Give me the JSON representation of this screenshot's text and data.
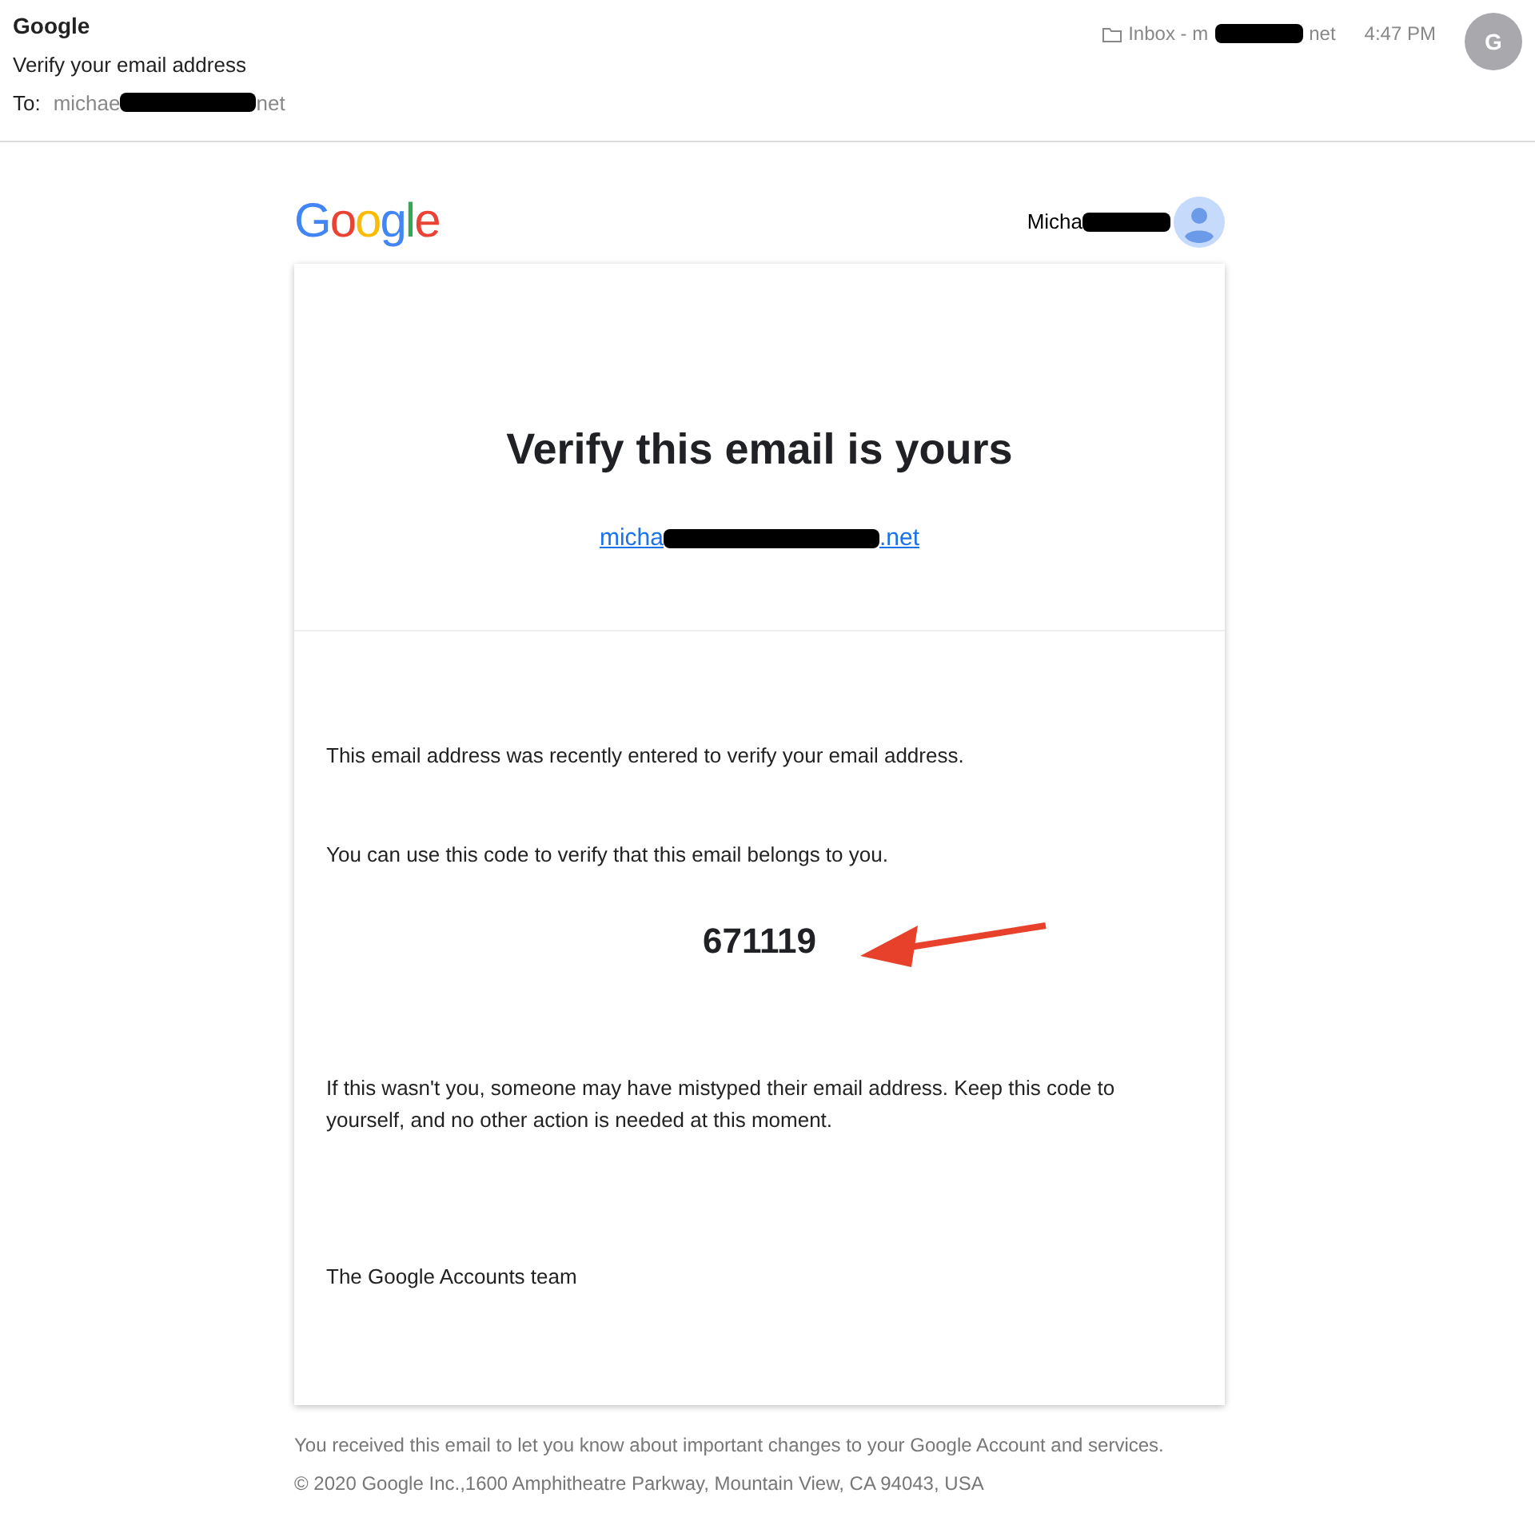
{
  "header": {
    "sender": "Google",
    "subject": "Verify your email address",
    "to_label": "To:",
    "to_start": "michae",
    "to_end": "net",
    "folder_start": "Inbox - m",
    "folder_end": "net",
    "time": "4:47 PM",
    "avatar": "G"
  },
  "email": {
    "logo": "Google",
    "account_name": "Micha",
    "title": "Verify this email is yours",
    "address_start": "micha",
    "address_end": ".net",
    "paragraphs": [
      "This email address was recently entered to verify your email address.",
      "You can use this code to verify that this email belongs to you."
    ],
    "code": "671119",
    "notice": "If this wasn't you, someone may have mistyped their email address. Keep this code to yourself, and no other action is needed at this moment.",
    "signature": "The Google Accounts team"
  },
  "footer": [
    "You received this email to let you know about important changes to your Google Account and services.",
    "© 2020 Google Inc.,1600 Amphitheatre Parkway, Mountain View, CA 94043, USA"
  ]
}
